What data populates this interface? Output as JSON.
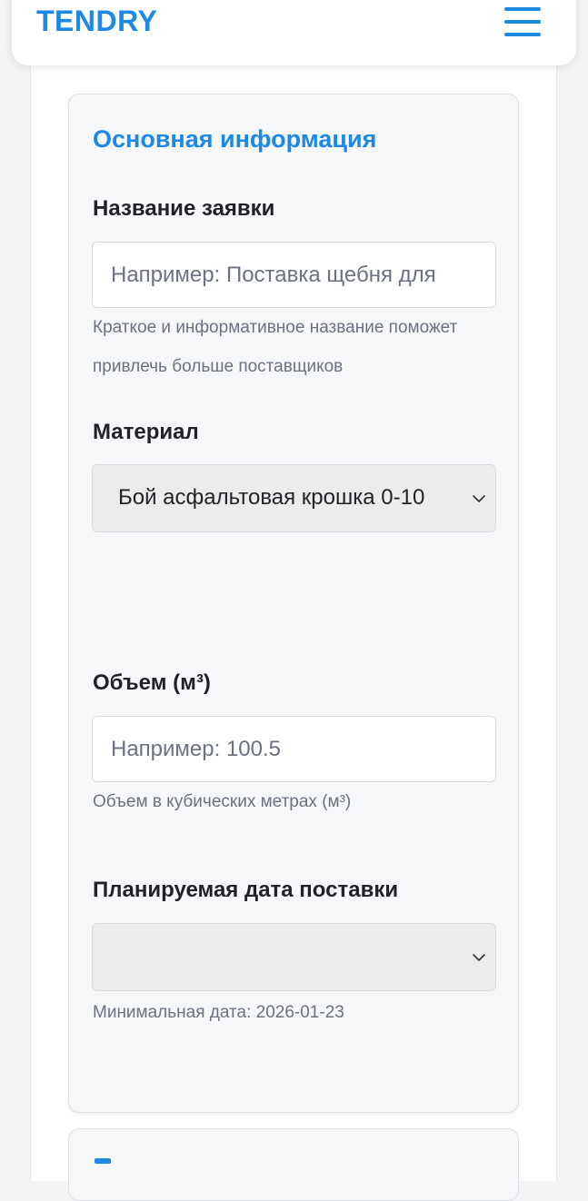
{
  "header": {
    "logo": "TENDRY",
    "menu_icon": "hamburger-menu-icon"
  },
  "card": {
    "section_title": "Основная информация",
    "name_field": {
      "label": "Название заявки",
      "placeholder": "Например: Поставка щебня для",
      "value": "",
      "hint": "Краткое и информативное название поможет привлечь больше поставщиков"
    },
    "material_field": {
      "label": "Материал",
      "selected": "Бой асфальтовая крошка 0-10",
      "chevron_icon": "chevron-down-icon"
    },
    "volume_field": {
      "label": "Объем (м³)",
      "placeholder": "Например: 100.5",
      "value": "",
      "hint": "Объем в кубических метрах (м³)"
    },
    "date_field": {
      "label": "Планируемая дата поставки",
      "selected": "",
      "chevron_icon": "chevron-down-icon",
      "hint": "Минимальная дата: 2026-01-23"
    }
  },
  "colors": {
    "accent": "#1e88e5",
    "card_background": "#f6f7f9",
    "select_background": "#ececec",
    "hint_text": "#6b7280"
  }
}
